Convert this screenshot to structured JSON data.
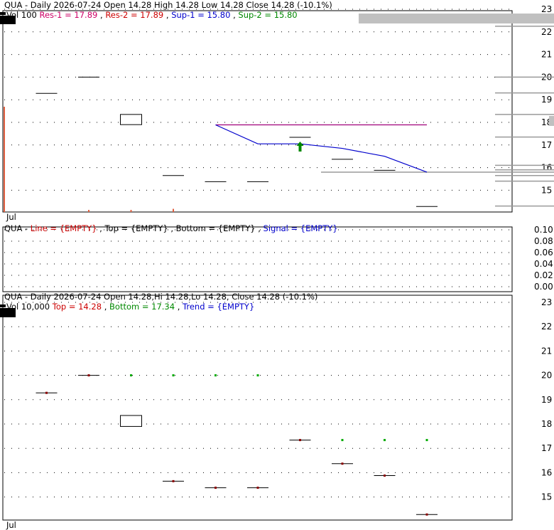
{
  "chart_data": [
    {
      "type": "candlestick",
      "header": {
        "title": "QUA - Daily 2026-07-24 Open 14.28  High 14.28  Low 14.28  Close 14.28 (-10.1%)",
        "vol_prefix": "Vol 100",
        "res1": "Res-1 = 17.89",
        "res2": "Res-2 = 17.89",
        "sup1": "Sup-1 = 15.80",
        "sup2": "Sup-2 = 15.80"
      },
      "x_label": "Jul",
      "ylim": [
        14.2,
        23.2
      ],
      "y_ticks": [
        15,
        16,
        17,
        18,
        19,
        20,
        21,
        22,
        23
      ],
      "candles": [
        {
          "i": 1,
          "open": 19.28,
          "close": 19.28
        },
        {
          "i": 2,
          "open": 20.0,
          "close": 20.0
        },
        {
          "i": 3,
          "open": 18.35,
          "close": 17.9
        },
        {
          "i": 4,
          "open": 15.65,
          "close": 15.65
        },
        {
          "i": 5,
          "open": 15.38,
          "close": 15.38
        },
        {
          "i": 6,
          "open": 15.38,
          "close": 15.38
        },
        {
          "i": 7,
          "open": 17.34,
          "close": 17.34
        },
        {
          "i": 8,
          "open": 16.37,
          "close": 16.37
        },
        {
          "i": 9,
          "open": 15.88,
          "close": 15.88
        },
        {
          "i": 10,
          "open": 14.28,
          "close": 14.28
        }
      ],
      "resistance_line": {
        "from_i": 5,
        "to_i": 10,
        "value": 17.89,
        "color": "#a0007a"
      },
      "support_line": [
        {
          "i": 5,
          "value": 17.89
        },
        {
          "i": 6,
          "value": 17.05
        },
        {
          "i": 7,
          "value": 17.05
        },
        {
          "i": 8,
          "value": 16.85
        },
        {
          "i": 9,
          "value": 16.5
        },
        {
          "i": 10,
          "value": 15.8
        }
      ],
      "support_color": "#0000cc",
      "buy_arrow": {
        "i": 7,
        "value": 16.9
      },
      "volume_bars": [
        {
          "i": 0,
          "value": 100
        },
        {
          "i": 2,
          "value": 2
        },
        {
          "i": 3,
          "value": 2
        },
        {
          "i": 4,
          "value": 3
        }
      ],
      "right_side_levels": [
        22.25,
        20.0,
        19.3,
        18.35,
        17.35,
        16.1,
        15.9,
        15.65,
        15.4,
        14.3
      ]
    },
    {
      "type": "line",
      "header": {
        "prefix": "QUA - ",
        "line": "Line = {EMPTY}",
        "top": "Top = {EMPTY}",
        "bottom": "Bottom = {EMPTY}",
        "signal": "Signal = {EMPTY}"
      },
      "ylim": [
        0,
        0.1
      ],
      "y_ticks": [
        "0.10",
        "0.08",
        "0.06",
        "0.04",
        "0.02",
        "0.00"
      ]
    },
    {
      "type": "candlestick",
      "header": {
        "title": "QUA - Daily 2026-07-24 Open 14.28,Hi 14.28,Lo 14.28, Close 14.28 (-10.1%)",
        "vol_prefix": "Vol 10,000",
        "top": "Top = 14.28",
        "bottom": "Bottom = 17.34",
        "trend": "Trend = {EMPTY}"
      },
      "x_label": "Jul",
      "ylim": [
        14.2,
        23.2
      ],
      "y_ticks": [
        15,
        16,
        17,
        18,
        19,
        20,
        21,
        22,
        23
      ],
      "candles": [
        {
          "i": 1,
          "open": 19.28,
          "close": 19.28
        },
        {
          "i": 2,
          "open": 20.0,
          "close": 20.0
        },
        {
          "i": 3,
          "open": 18.35,
          "close": 17.9
        },
        {
          "i": 4,
          "open": 15.65,
          "close": 15.65
        },
        {
          "i": 5,
          "open": 15.38,
          "close": 15.38
        },
        {
          "i": 6,
          "open": 15.38,
          "close": 15.38
        },
        {
          "i": 7,
          "open": 17.34,
          "close": 17.34
        },
        {
          "i": 8,
          "open": 16.37,
          "close": 16.37
        },
        {
          "i": 9,
          "open": 15.88,
          "close": 15.88
        },
        {
          "i": 10,
          "open": 14.28,
          "close": 14.28
        }
      ],
      "green_markers": [
        {
          "i": 3,
          "value": 20.0
        },
        {
          "i": 4,
          "value": 20.0
        },
        {
          "i": 5,
          "value": 20.0
        },
        {
          "i": 6,
          "value": 20.0
        },
        {
          "i": 8,
          "value": 17.34
        },
        {
          "i": 9,
          "value": 17.34
        },
        {
          "i": 10,
          "value": 17.34
        }
      ]
    }
  ],
  "colors": {
    "res1": "#cc0066",
    "res2": "#cc0000",
    "sup1": "#0000cc",
    "sup2": "#008800",
    "line": "#cc0000",
    "top_green": "#008800",
    "bottom_green": "#008800",
    "trend_blue": "#0000cc",
    "top_red": "#cc0000",
    "candle_mark": "#8b0000",
    "volume": "#e06040"
  }
}
